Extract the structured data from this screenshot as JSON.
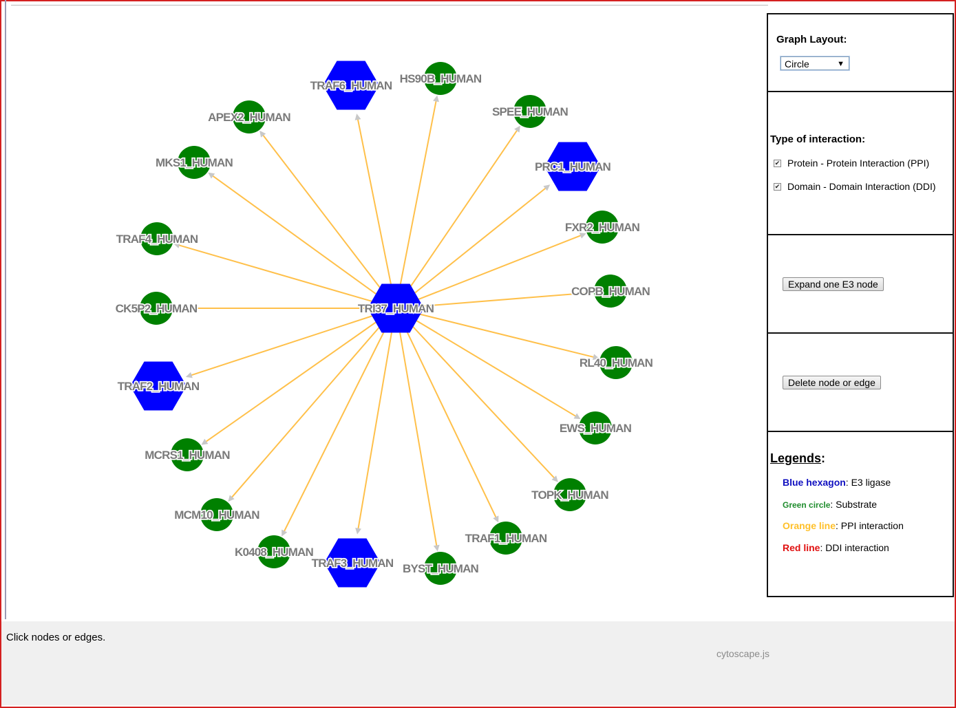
{
  "graph": {
    "center": {
      "id": "TRI37_HUMAN",
      "type": "E3"
    },
    "nodes": [
      {
        "id": "TRAF6_HUMAN",
        "type": "E3"
      },
      {
        "id": "HS90B_HUMAN",
        "type": "Substrate"
      },
      {
        "id": "SPEE_HUMAN",
        "type": "Substrate"
      },
      {
        "id": "PRC1_HUMAN",
        "type": "E3"
      },
      {
        "id": "FXR2_HUMAN",
        "type": "Substrate"
      },
      {
        "id": "COPB_HUMAN",
        "type": "Substrate"
      },
      {
        "id": "RL40_HUMAN",
        "type": "Substrate"
      },
      {
        "id": "EWS_HUMAN",
        "type": "Substrate"
      },
      {
        "id": "TOPK_HUMAN",
        "type": "Substrate"
      },
      {
        "id": "TRAF1_HUMAN",
        "type": "Substrate"
      },
      {
        "id": "BYST_HUMAN",
        "type": "Substrate"
      },
      {
        "id": "TRAF3_HUMAN",
        "type": "E3"
      },
      {
        "id": "K0408_HUMAN",
        "type": "Substrate"
      },
      {
        "id": "MCM10_HUMAN",
        "type": "Substrate"
      },
      {
        "id": "MCRS1_HUMAN",
        "type": "Substrate"
      },
      {
        "id": "TRAF2_HUMAN",
        "type": "E3"
      },
      {
        "id": "CK5P2_HUMAN",
        "type": "Substrate"
      },
      {
        "id": "TRAF4_HUMAN",
        "type": "Substrate"
      },
      {
        "id": "MKS1_HUMAN",
        "type": "Substrate"
      },
      {
        "id": "APEX2_HUMAN",
        "type": "Substrate"
      }
    ],
    "edge_type": "PPI",
    "colors": {
      "e3": "#0000ff",
      "substrate": "#008000",
      "ppi_edge": "#ffc04a",
      "arrow": "#c8c8c8",
      "label": "#7a7a7a"
    }
  },
  "controls": {
    "layout_label": "Graph Layout:",
    "layout_value": "Circle",
    "interaction_label": "Type of interaction:",
    "ppi_label": "Protein - Protein Interaction (PPI)",
    "ppi_checked": true,
    "ddi_label": "Domain - Domain Interaction (DDI)",
    "ddi_checked": true,
    "expand_button": "Expand one E3 node",
    "delete_button": "Delete node or edge"
  },
  "legend": {
    "title": "Legends",
    "items": [
      {
        "key": "Blue hexagon",
        "desc": ": E3 ligase",
        "color": "#1010c0"
      },
      {
        "key": "Green circle",
        "desc": ": Substrate",
        "color": "#1e8c2c"
      },
      {
        "key": "Orange line",
        "desc": ": PPI interaction",
        "color": "#ffc02a"
      },
      {
        "key": "Red line",
        "desc": ": DDI interaction",
        "color": "#e01010"
      }
    ]
  },
  "status": {
    "message": "Click nodes or edges.",
    "credit": "cytoscape.js"
  }
}
